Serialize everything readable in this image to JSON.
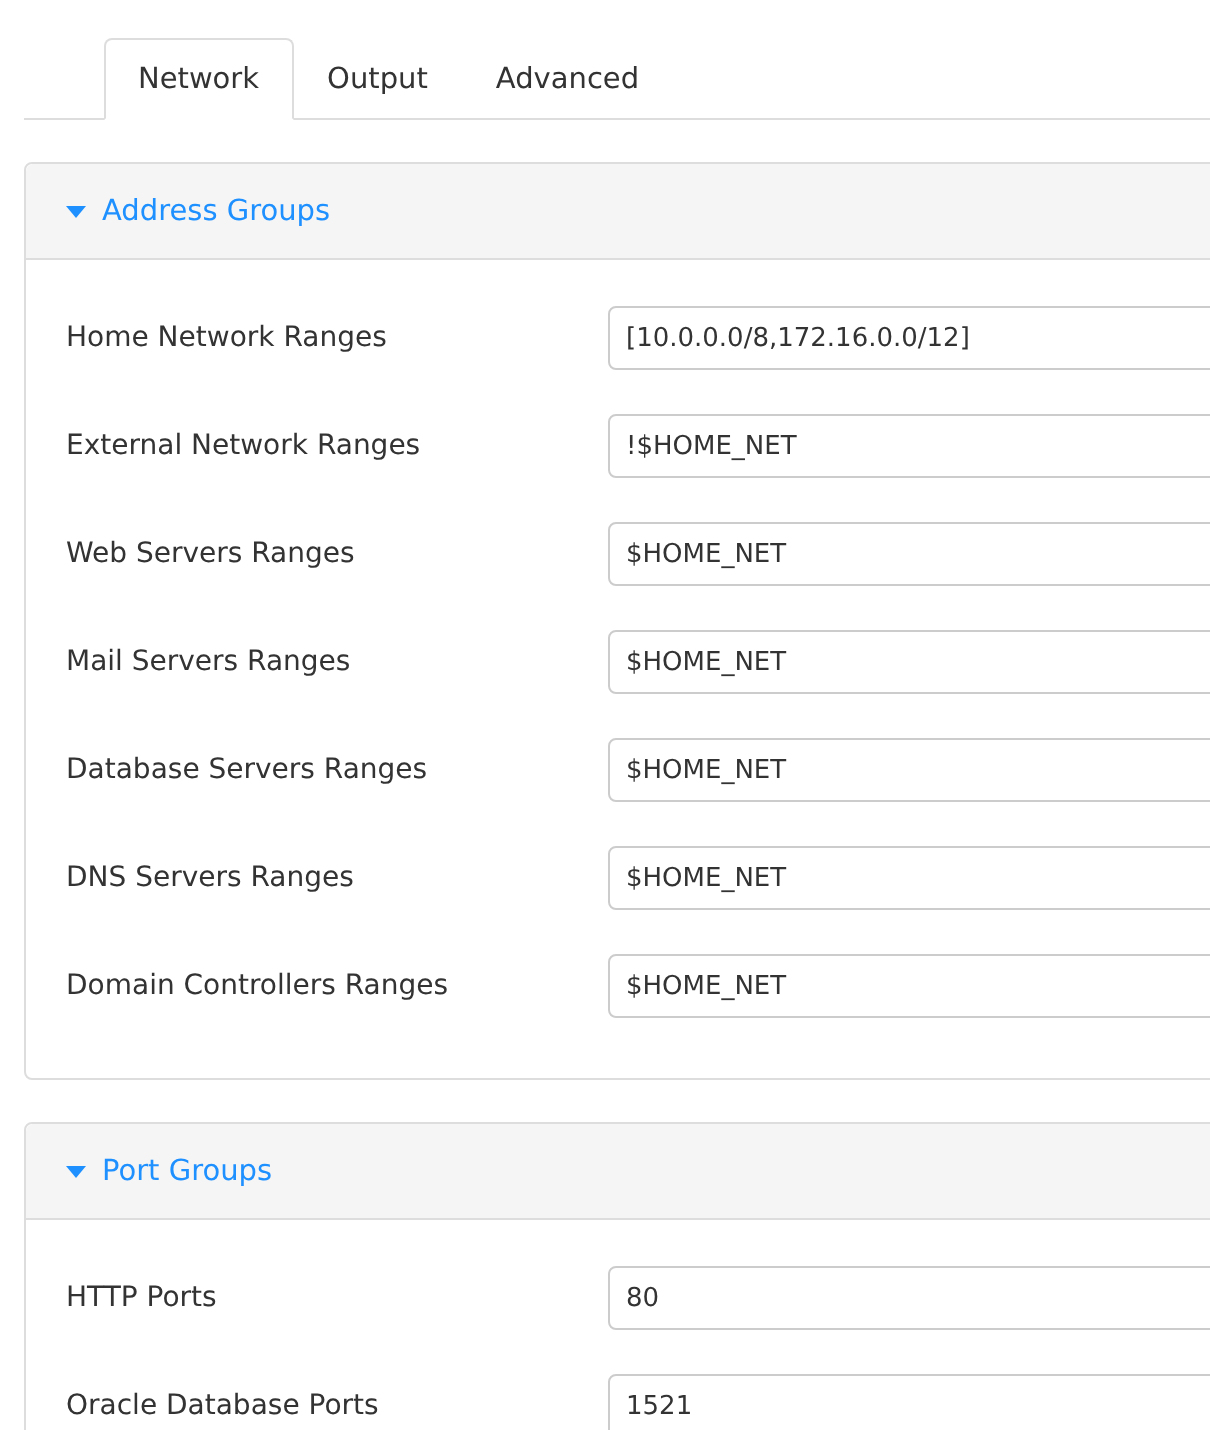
{
  "tabs": [
    {
      "label": "Network",
      "selected": true
    },
    {
      "label": "Output",
      "selected": false
    },
    {
      "label": "Advanced",
      "selected": false
    }
  ],
  "panels": [
    {
      "title": "Address Groups",
      "expanded": true,
      "fields": [
        {
          "label": "Home Network Ranges",
          "value": "[10.0.0.0/8,172.16.0.0/12]"
        },
        {
          "label": "External Network Ranges",
          "value": "!$HOME_NET"
        },
        {
          "label": "Web Servers Ranges",
          "value": "$HOME_NET"
        },
        {
          "label": "Mail Servers Ranges",
          "value": "$HOME_NET"
        },
        {
          "label": "Database Servers Ranges",
          "value": "$HOME_NET"
        },
        {
          "label": "DNS Servers Ranges",
          "value": "$HOME_NET"
        },
        {
          "label": "Domain Controllers Ranges",
          "value": "$HOME_NET"
        }
      ]
    },
    {
      "title": "Port Groups",
      "expanded": true,
      "fields": [
        {
          "label": "HTTP Ports",
          "value": "80"
        },
        {
          "label": "Oracle Database Ports",
          "value": "1521"
        }
      ]
    }
  ]
}
